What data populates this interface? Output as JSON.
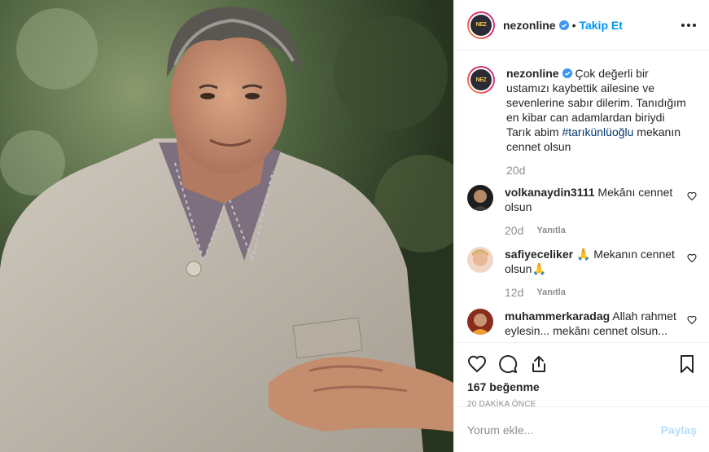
{
  "header": {
    "username": "nezonline",
    "avatar_text": "NEZ",
    "separator": "•",
    "follow_label": "Takip Et"
  },
  "caption": {
    "username": "nezonline",
    "text_before": " Çok değerli bir ustamızı kaybettik ailesine ve sevenlerine sabır dilerim. Tanıdığım en kibar can adamlardan biriydi Tarık abim ",
    "hashtag": "#tarıkünlüoğlu",
    "text_after": " mekanın cennet olsun",
    "time": "20d"
  },
  "comments": [
    {
      "username": "volkanaydin3111",
      "text": "Mekânı cennet olsun",
      "time": "20d",
      "reply_label": "Yanıtla"
    },
    {
      "username": "safiyeceliker",
      "text": "🙏 Mekanın cennet olsun🙏",
      "time": "12d",
      "reply_label": "Yanıtla"
    },
    {
      "username": "muhammerkaradag",
      "text": "Allah rahmet eylesin... mekânı cennet olsun..."
    }
  ],
  "actions": {
    "likes": "167 beğenme",
    "posted_ago": "20 DAKİKA ÖNCE"
  },
  "add_comment": {
    "placeholder": "Yorum ekle...",
    "post_label": "Paylaş"
  },
  "colors": {
    "link": "#0095f6",
    "hashtag": "#00376b",
    "muted": "#8e8e8e",
    "post_disabled": "#b2dffc"
  }
}
